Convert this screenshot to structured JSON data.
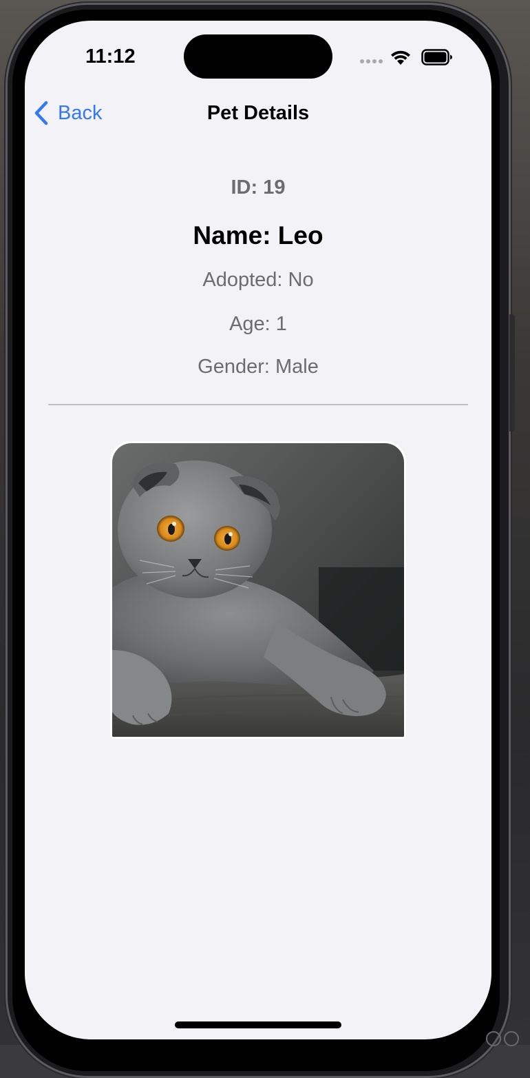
{
  "status_bar": {
    "time": "11:12",
    "icons": [
      "signal-dots-icon",
      "wifi-icon",
      "battery-icon"
    ]
  },
  "nav": {
    "back_label": "Back",
    "title": "Pet Details"
  },
  "pet": {
    "id_text": "ID: 19",
    "name_text": "Name: Leo",
    "adopted_text": "Adopted: No",
    "age_text": "Age: 1",
    "gender_text": "Gender: Male"
  },
  "colors": {
    "accent": "#3478f6",
    "background": "#f2f2f7",
    "secondary_text": "#6c6c70",
    "divider": "#c0c0c4"
  }
}
